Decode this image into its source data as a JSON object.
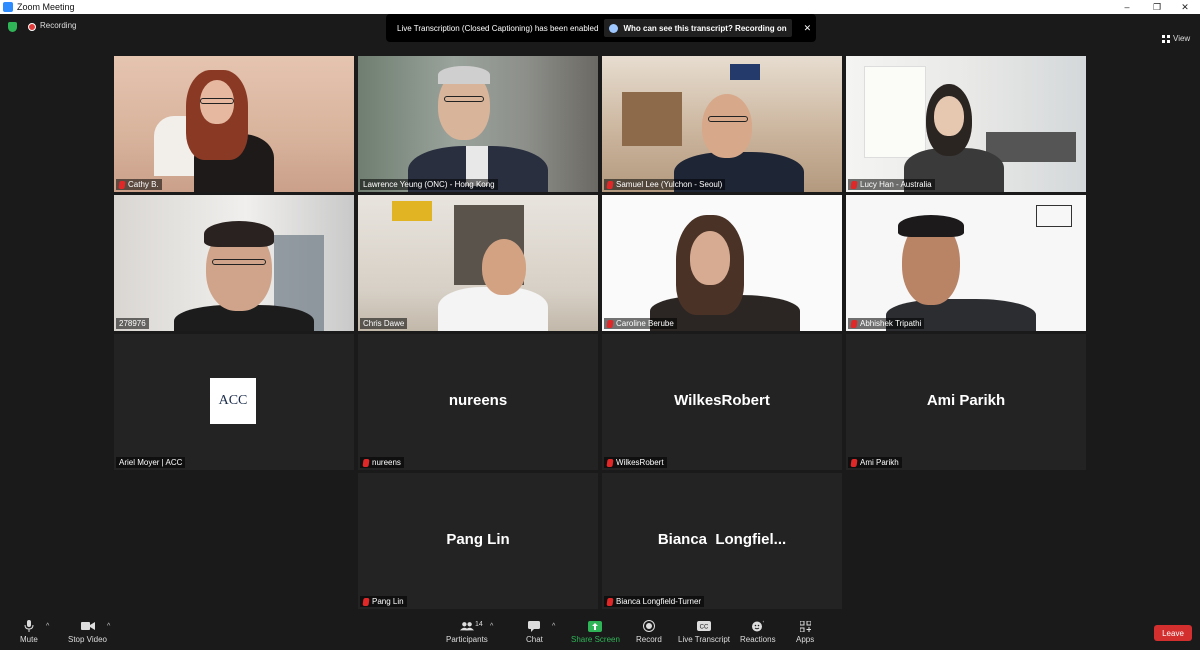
{
  "window": {
    "title": "Zoom Meeting",
    "minimize": "–",
    "restore": "❐",
    "close": "✕"
  },
  "status": {
    "recording_label": "Recording",
    "view_label": "View"
  },
  "banner": {
    "message": "Live Transcription (Closed Captioning) has been enabled",
    "chip": "Who can see this transcript? Recording on",
    "close": "✕"
  },
  "participants": [
    {
      "name": "Cathy B."
    },
    {
      "name": "Lawrence Yeung (ONC) - Hong Kong"
    },
    {
      "name": "Samuel Lee (Yulchon - Seoul)"
    },
    {
      "name": "Lucy Han - Australia"
    },
    {
      "name": "278976"
    },
    {
      "name": "Chris Dawe"
    },
    {
      "name": "Caroline Berube"
    },
    {
      "name": "Abhishek Tripathi"
    },
    {
      "name": "Ariel Moyer | ACC",
      "logo": "ACC"
    },
    {
      "name": "nureens",
      "display": "nureens"
    },
    {
      "name": "WilkesRobert",
      "display": "WilkesRobert"
    },
    {
      "name": "Ami Parikh",
      "display": "Ami Parikh"
    },
    {
      "name": "Pang Lin",
      "display": "Pang Lin"
    },
    {
      "name": "Bianca Longfield-Turner",
      "display": "Bianca  Longfiel..."
    }
  ],
  "toolbar": {
    "mute": "Mute",
    "stop_video": "Stop Video",
    "participants": "Participants",
    "participants_count": "14",
    "chat": "Chat",
    "share_screen": "Share Screen",
    "record": "Record",
    "live_transcript": "Live Transcript",
    "reactions": "Reactions",
    "apps": "Apps",
    "leave": "Leave",
    "caret": "^"
  },
  "colors": {
    "active_speaker": "#9be22d",
    "leave": "#d32f2f",
    "share": "#2fb457"
  }
}
